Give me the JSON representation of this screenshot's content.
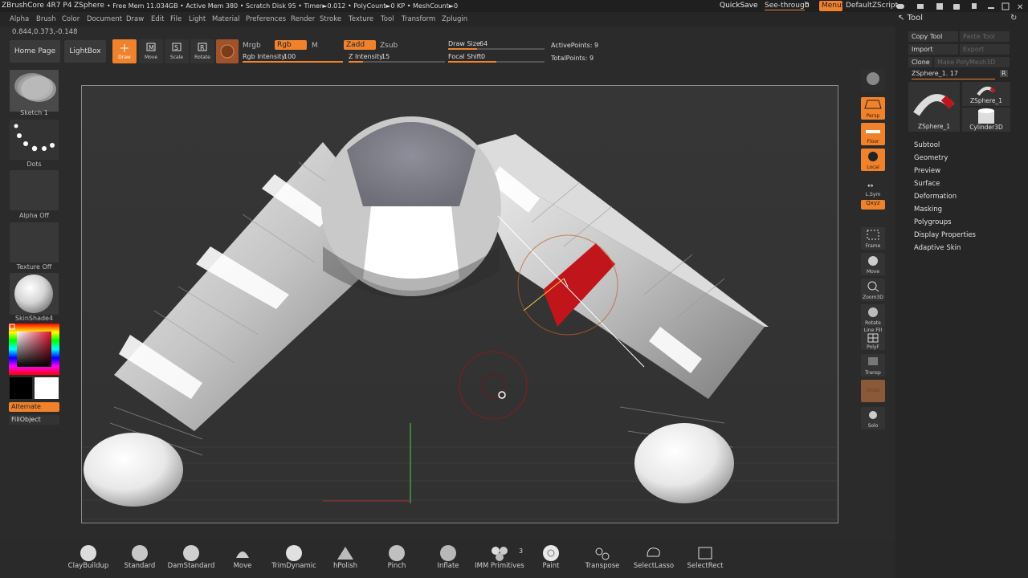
{
  "titlebar": {
    "app": "ZBrushCore 4R7 P4",
    "document": "ZSphere",
    "stats": "• Free Mem 11.034GB • Active Mem 380 • Scratch Disk 95 • Timer►0.012 • PolyCount►0 KP • MeshCount►0",
    "quicksave": "QuickSave",
    "seethrough_label": "See-through",
    "seethrough_value": "0",
    "menus": "Menus",
    "script": "DefaultZScript"
  },
  "menubar": [
    "Alpha",
    "Brush",
    "Color",
    "Document",
    "Draw",
    "Edit",
    "File",
    "Light",
    "Material",
    "Preferences",
    "Render",
    "Stroke",
    "Texture",
    "Tool",
    "Transform",
    "Zplugin"
  ],
  "coords": "0.844,0.373,-0.148",
  "toolbar": {
    "home": "Home Page",
    "lightbox": "LightBox",
    "draw": "Draw",
    "move": "Move",
    "scale": "Scale",
    "rotate": "Rotate",
    "mrgb": "Mrgb",
    "rgb": "Rgb",
    "m": "M",
    "rgb_intensity_label": "Rgb Intensity",
    "rgb_intensity": "100",
    "zadd": "Zadd",
    "zsub": "Zsub",
    "z_intensity_label": "Z Intensity",
    "z_intensity": "15",
    "draw_size_label": "Draw Size",
    "draw_size": "64",
    "focal_shift_label": "Focal Shift",
    "focal_shift": "0",
    "active_points": "ActivePoints: 9",
    "total_points": "TotalPoints: 9"
  },
  "leftshelf": {
    "sketch": "Sketch 1",
    "dots": "Dots",
    "alpha": "Alpha Off",
    "texture": "Texture Off",
    "material": "SkinShade4",
    "alternate": "Alternate",
    "fillobject": "FillObject"
  },
  "rightshelf": [
    "BPR",
    "Persp",
    "Floor",
    "Local",
    "L.Sym",
    "Qxyz",
    "Frame",
    "Move",
    "Zoom3D",
    "Rotate",
    "Line Fill",
    "PolyF",
    "Transp",
    "Ghost",
    "Solo"
  ],
  "toolpanel": {
    "title": "Tool",
    "copy_tool": "Copy Tool",
    "paste_tool": "Paste Tool",
    "import": "Import",
    "export": "Export",
    "clone": "Clone",
    "make_polymesh": "Make PolyMesh3D",
    "zsphere_slider": "ZSphere_1. 17",
    "r": "R",
    "thumb1": "ZSphere_1",
    "thumb2": "ZSphere_1",
    "thumb3": "Cylinder3D",
    "sections": [
      "Subtool",
      "Geometry",
      "Preview",
      "Surface",
      "Deformation",
      "Masking",
      "Polygroups",
      "Display Properties",
      "Adaptive Skin"
    ]
  },
  "brushes": [
    "ClayBuildup",
    "Standard",
    "DamStandard",
    "Move",
    "TrimDynamic",
    "hPolish",
    "Pinch",
    "Inflate",
    "IMM Primitives",
    "Paint",
    "Transpose",
    "SelectLasso",
    "SelectRect"
  ],
  "imm_count": "3",
  "colors": {
    "accent": "#f0822c",
    "highlight": "#c0161b"
  }
}
